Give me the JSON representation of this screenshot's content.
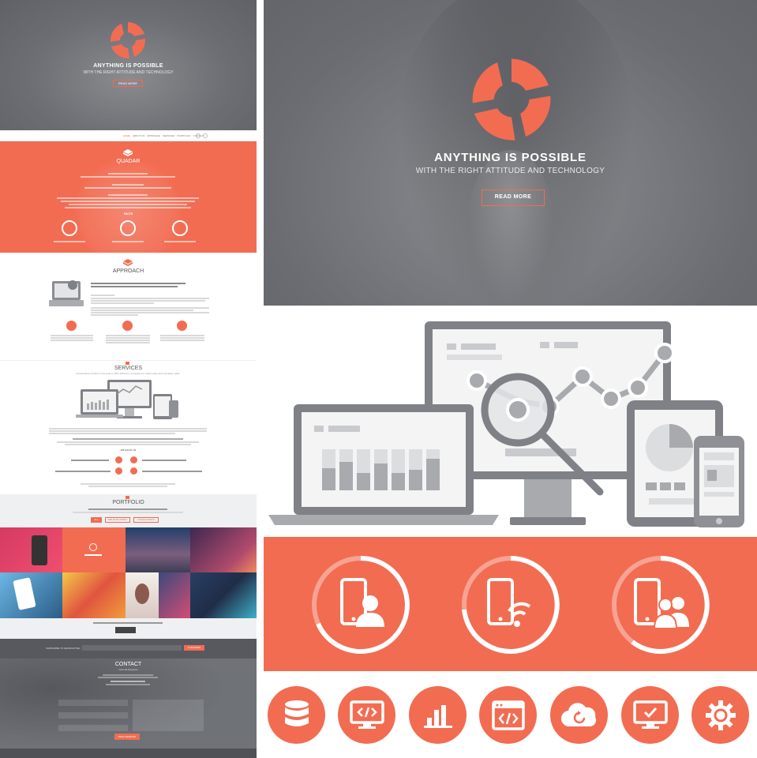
{
  "hero": {
    "title": "ANYTHING IS POSSIBLE",
    "subtitle": "WITH THE RIGHT ATTITUDE AND TECHNOLOGY",
    "button_label": "READ MORE"
  },
  "preview": {
    "hero_title": "ANYTHING IS POSSIBLE",
    "hero_subtitle": "WITH THE RIGHT ATTITUDE AND TECHNOLOGY",
    "hero_button": "READ MORE",
    "nav_items": [
      "HOME",
      "ABOUT US",
      "APPROACH",
      "SERVICES",
      "PORTFOLIO",
      "CONTACT"
    ],
    "about_title": "QUADAR",
    "facts_label": "FACTS",
    "approach_title": "APPROACH",
    "approach_headline": "WE SERVE OF BOUND, DIGITAL, DATA, AND DISTRIBUTION SOLUTIONS TO HELP OUR CLIENTS FUNCTION BETTER.",
    "approach_items": [
      "DIGITAL",
      "DATA",
      "DISTRIBUTION"
    ],
    "services_title": "SERVICES",
    "services_subtitle": "Extraordinary solution is the goal to drive efficiency, transparency, brand value and ultimately, sales.",
    "excel_label": "WE EXCEL IN",
    "portfolio_title": "PORTFOLIO",
    "portfolio_filters": [
      "ALL",
      "WEB DEVELOPMENT",
      "UI DEVELOPMENT"
    ],
    "contact_title": "CONTACT",
    "contact_subtitle": "General Enquiries",
    "subscribe_label": "SUBSCRIBE TO NEWSLETTER",
    "subscribe_button": "SUBSCRIBE",
    "send_button": "SEND MESSAGE"
  },
  "colors": {
    "accent": "#f26c52",
    "dark_gray": "#6f7277",
    "device_gray": "#7f8187",
    "light_gray": "#d7d8db"
  },
  "icons": {
    "features": [
      "mobile-user-icon",
      "mobile-wifi-icon",
      "mobile-group-icon"
    ],
    "services": [
      "database-icon",
      "code-monitor-icon",
      "bar-chart-icon",
      "code-window-icon",
      "cloud-sync-icon",
      "monitor-check-icon",
      "settings-gear-icon"
    ]
  }
}
